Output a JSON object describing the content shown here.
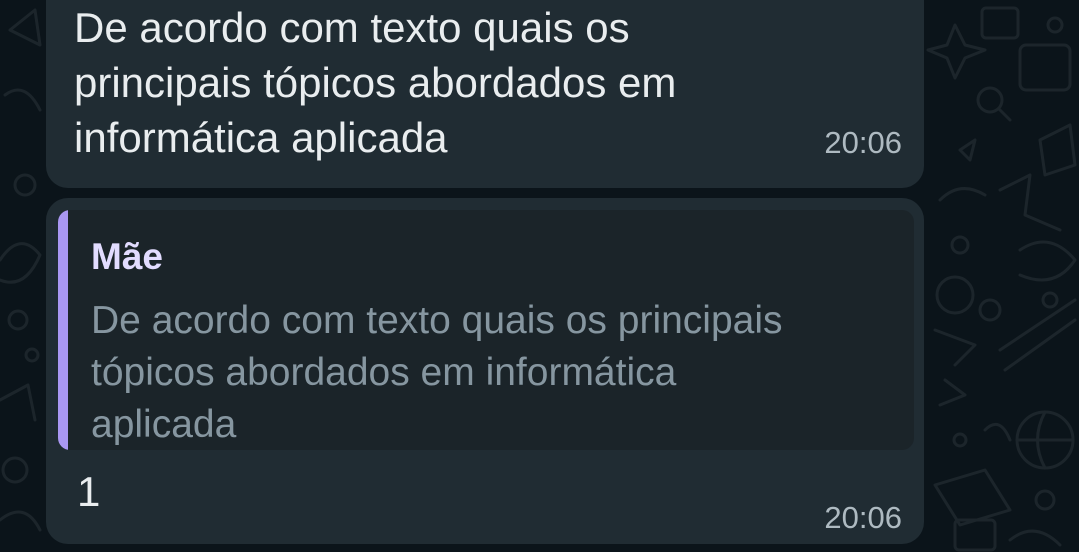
{
  "messages": [
    {
      "text": "De acordo com texto quais os\nprincipais tópicos abordados em\ninformática aplicada",
      "time": "20:06"
    },
    {
      "quoted": {
        "sender": "Mãe",
        "text": "De acordo com texto quais os principais\ntópicos abordados em informática\naplicada"
      },
      "text": "1",
      "time": "20:06"
    }
  ],
  "colors": {
    "background": "#0b141a",
    "bubble": "#202c33",
    "quote_accent": "#a997f2",
    "text": "#e9edef",
    "meta_text": "#aebac1"
  },
  "icons": [
    "chat-wallpaper-doodle-icons"
  ]
}
